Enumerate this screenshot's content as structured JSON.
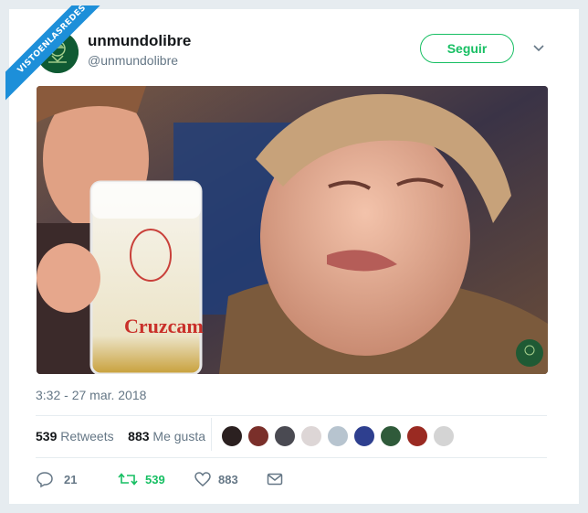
{
  "watermark": {
    "text": "VISTOENLASREDES"
  },
  "tweet": {
    "display_name": "unmundolibre",
    "handle": "@unmundolibre",
    "follow_label": "Seguir",
    "photo": {
      "mug_text": "Cruzcam"
    },
    "timestamp": "3:32 - 27 mar. 2018",
    "retweets_count": "539",
    "retweets_label": "Retweets",
    "likes_count": "883",
    "likes_label": "Me gusta",
    "actions": {
      "reply_count": "21",
      "retweet_count": "539",
      "like_count": "883"
    }
  },
  "colors": {
    "accent_green": "#17bf63",
    "muted": "#657786",
    "banner": "#1d8fd9"
  },
  "icons": [
    "chevron-down-icon",
    "reply-icon",
    "retweet-icon",
    "heart-icon",
    "message-icon"
  ]
}
